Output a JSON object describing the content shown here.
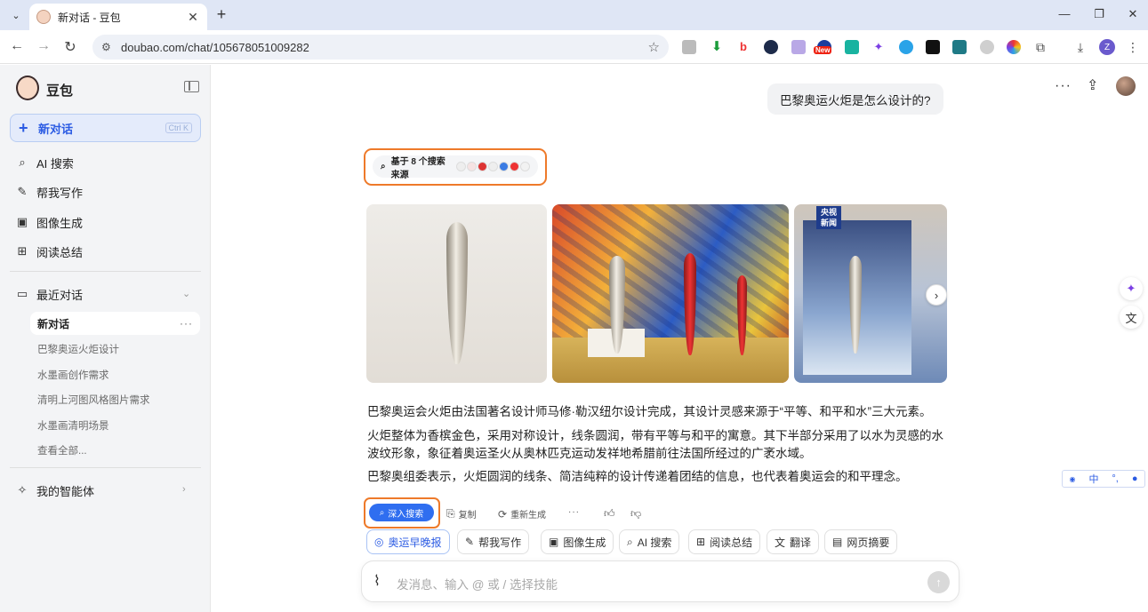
{
  "browser": {
    "tab_title": "新对话 - 豆包",
    "url": "doubao.com/chat/105678051009282",
    "ext_badge": "New",
    "profile_initial": "Z"
  },
  "sidebar": {
    "brand": "豆包",
    "new_chat_label": "新对话",
    "new_chat_shortcut": "Ctrl K",
    "nav": [
      {
        "label": "AI 搜索",
        "icon": "search-icon"
      },
      {
        "label": "帮我写作",
        "icon": "pen-icon"
      },
      {
        "label": "图像生成",
        "icon": "image-icon"
      },
      {
        "label": "阅读总结",
        "icon": "reader-icon"
      }
    ],
    "recent_header": "最近对话",
    "recent_active": "新对话",
    "recent_items": [
      "巴黎奥运火炬设计",
      "水墨画创作需求",
      "清明上河图风格图片需求",
      "水墨画清明场景",
      "查看全部..."
    ],
    "agents_label": "我的智能体"
  },
  "chat": {
    "user_message": "巴黎奥运火炬是怎么设计的?",
    "sources_label": "基于 8 个搜索来源",
    "image3_logo": "央视\n新闻",
    "answer_paragraphs": [
      "巴黎奥运会火炬由法国著名设计师马修·勒汉纽尔设计完成，其设计灵感来源于“平等、和平和水”三大元素。",
      "火炬整体为香槟金色，采用对称设计，线条圆润，带有平等与和平的寓意。其下半部分采用了以水为灵感的水波纹形象，象征着奥运圣火从奥林匹克运动发祥地希腊前往法国所经过的广袤水域。",
      "巴黎奥组委表示，火炬圆润的线条、简洁纯粹的设计传递着团结的信息，也代表着奥运会的和平理念。"
    ],
    "actions": {
      "deep_search": "深入搜索",
      "copy": "复制",
      "regenerate": "重新生成"
    },
    "skills": [
      "奥运早晚报",
      "帮我写作",
      "图像生成",
      "AI 搜索",
      "阅读总结",
      "翻译",
      "网页摘要"
    ],
    "input_placeholder": "发消息、输入 @ 或 / 选择技能"
  },
  "ime": {
    "lang": "中"
  },
  "colors": {
    "accent": "#2b5be3",
    "highlight": "#ee7a2a"
  }
}
